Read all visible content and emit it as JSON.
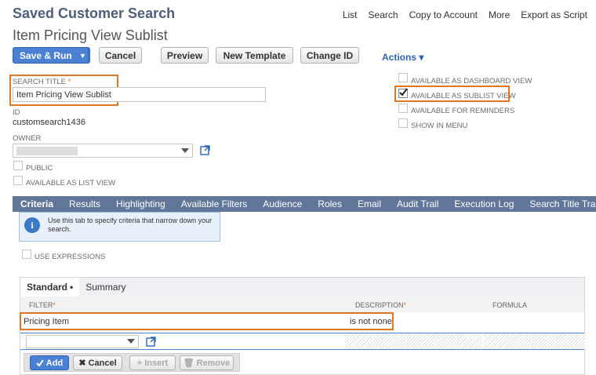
{
  "header": {
    "page_heading": "Saved Customer Search",
    "subtitle": "Item Pricing View Sublist",
    "links": [
      "List",
      "Search",
      "Copy to Account",
      "More",
      "Export as Script"
    ]
  },
  "toolbar": {
    "save_run": "Save & Run",
    "cancel": "Cancel",
    "preview": "Preview",
    "new_template": "New Template",
    "change_id": "Change ID",
    "actions": "Actions",
    "dropdown_arrow": "▼",
    "actions_arrow": "▾"
  },
  "form": {
    "search_title_label": "SEARCH TITLE",
    "required_mark": "*",
    "search_title_value": "Item Pricing View Sublist",
    "id_label": "ID",
    "id_value": "customsearch1436",
    "owner_label": "OWNER",
    "public_label": "PUBLIC",
    "list_view_label": "AVAILABLE AS LIST VIEW"
  },
  "options": [
    {
      "label": "AVAILABLE AS DASHBOARD VIEW",
      "checked": false
    },
    {
      "label": "AVAILABLE AS SUBLIST VIEW",
      "checked": true
    },
    {
      "label": "AVAILABLE FOR REMINDERS",
      "checked": false
    },
    {
      "label": "SHOW IN MENU",
      "checked": false
    }
  ],
  "tabs": [
    "Criteria",
    "Results",
    "Highlighting",
    "Available Filters",
    "Audience",
    "Roles",
    "Email",
    "Audit Trail",
    "Execution Log",
    "Search Title Translation"
  ],
  "info": {
    "text": "Use this tab to specify criteria that narrow down your search."
  },
  "use_expressions": "USE EXPRESSIONS",
  "sublist": {
    "tabs": [
      "Standard",
      "Summary"
    ],
    "active_marker": "•",
    "columns": {
      "filter": "FILTER",
      "description": "DESCRIPTION",
      "formula": "FORMULA"
    },
    "rows": [
      {
        "filter": "Pricing Item",
        "description": "is not none"
      }
    ],
    "buttons": {
      "add": "Add",
      "cancel": "Cancel",
      "insert": "Insert",
      "remove": "Remove"
    }
  },
  "colors": {
    "accent": "#4a81d4",
    "tabbar": "#607799",
    "highlight": "#e07727"
  }
}
